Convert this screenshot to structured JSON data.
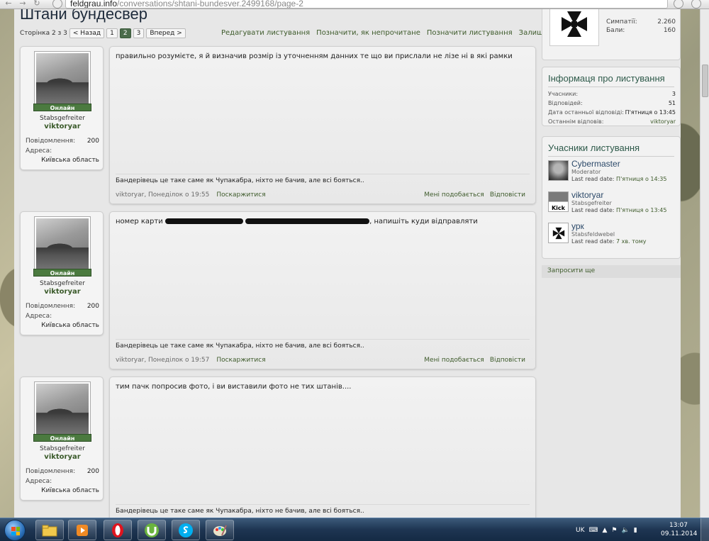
{
  "browser": {
    "url_host": "feldgrau.info",
    "url_path": "/conversations/shtani-bundesver.2499168/page-2"
  },
  "thread": {
    "title": "Штани бундесвер",
    "pager_label": "Сторінка 2 з 3",
    "prev_label": "< Назад",
    "pages": [
      "1",
      "2",
      "3"
    ],
    "current_page": "2",
    "next_label": "Вперед >",
    "actions": [
      "Редагувати листування",
      "Позначити, як непрочитане",
      "Позначити листування",
      "Залишити листування"
    ]
  },
  "posts": [
    {
      "rank": "Stabsgefreiter",
      "username": "viktoryar",
      "online_label": "Онлайн",
      "messages_label": "Повідомлення:",
      "messages_value": "200",
      "address_label": "Адреса:",
      "address_value": "Київська область",
      "text": "правильно розумієте, я й визначив розмір із уточненням данних те що ви прислали не лізе ні в які рамки",
      "signature": "Бандерівець це таке саме як Чупакабра, ніхто не бачив, але всі бояться..",
      "meta": "viktoryar, Понеділок о 19:55",
      "report": "Поскаржитися",
      "like": "Мені подобається",
      "reply": "Відповісти"
    },
    {
      "rank": "Stabsgefreiter",
      "username": "viktoryar",
      "online_label": "Онлайн",
      "messages_label": "Повідомлення:",
      "messages_value": "200",
      "address_label": "Адреса:",
      "address_value": "Київська область",
      "text_start": "номер карти",
      "text_end": ", напишіть куди відправляти",
      "signature": "Бандерівець це таке саме як Чупакабра, ніхто не бачив, але всі бояться..",
      "meta": "viktoryar, Понеділок о 19:57",
      "report": "Поскаржитися",
      "like": "Мені подобається",
      "reply": "Відповісти"
    },
    {
      "rank": "Stabsgefreiter",
      "username": "viktoryar",
      "online_label": "Онлайн",
      "messages_label": "Повідомлення:",
      "messages_value": "200",
      "address_label": "Адреса:",
      "address_value": "Київська область",
      "text": "тим пачк попросив фото, і ви виставили фото не тих штанів....",
      "signature": "Бандерівець це таке саме як Чупакабра, ніхто не бачив, але всі бояться.."
    }
  ],
  "sidebar": {
    "profile": {
      "likes_label": "Симпатії:",
      "likes_value": "2.260",
      "points_label": "Бали:",
      "points_value": "160"
    },
    "info": {
      "title": "Інформаця про листування",
      "rows": [
        {
          "label": "Учасники:",
          "value": "3"
        },
        {
          "label": "Відповідей:",
          "value": "51"
        },
        {
          "label": "Дата останньої відповіді:",
          "value": "П'ятниця о 13:45"
        },
        {
          "label": "Останнім відповів:",
          "value": "viktoryar"
        }
      ]
    },
    "participants": {
      "title": "Учасники листування",
      "items": [
        {
          "name": "Cybermaster",
          "rank": "Moderator",
          "read_label": "Last read date:",
          "read_value": "П'ятниця о 14:35"
        },
        {
          "name": "viktoryar",
          "rank": "Stabsgefreiter",
          "read_label": "Last read date:",
          "read_value": "П'ятниця о 13:45",
          "avatar_text": "Kick"
        },
        {
          "name": "урк",
          "rank": "Stabsfeldwebel",
          "read_label": "Last read date:",
          "read_value": "7 хв. тому"
        }
      ]
    },
    "invite_label": "Запросити ще"
  },
  "taskbar": {
    "lang": "UK",
    "time": "13:07",
    "date": "09.11.2014"
  },
  "colors": {
    "online": "#4b7a3f",
    "link_green": "#3d5a2a",
    "title_teal": "#2e5a4a"
  }
}
